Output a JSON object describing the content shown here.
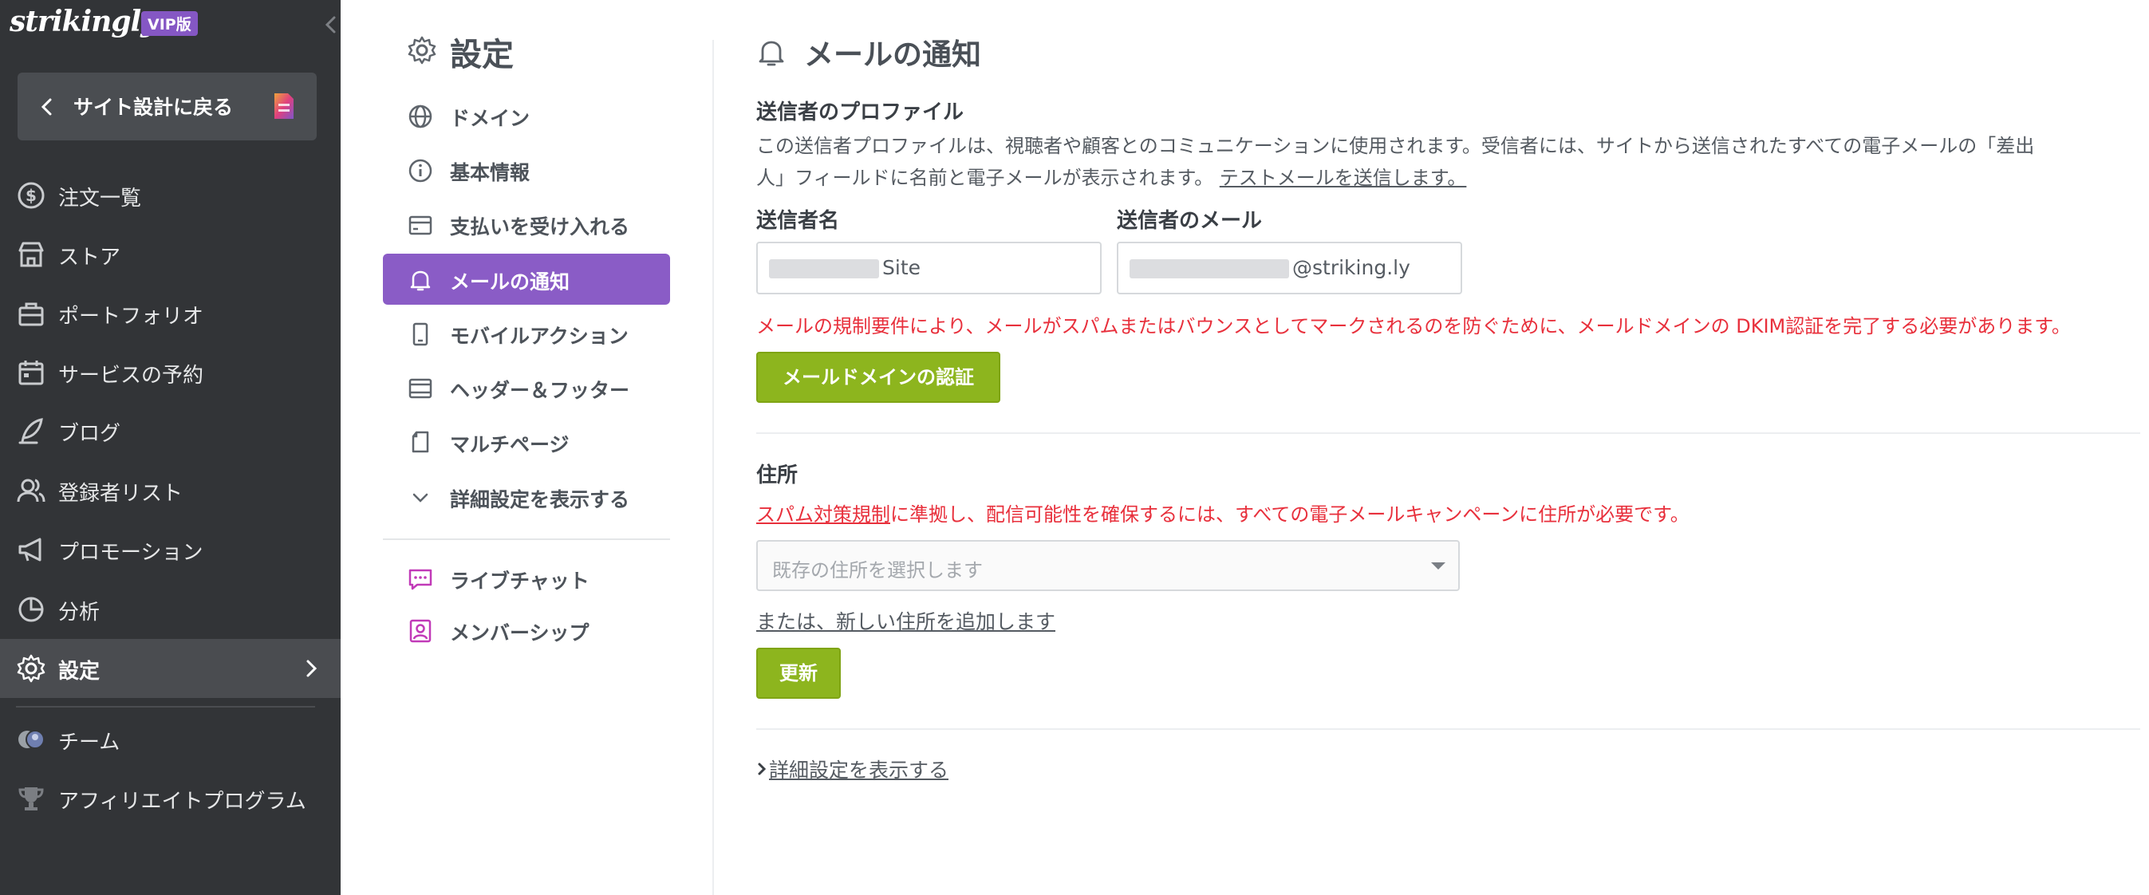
{
  "app": {
    "logo": "strikingly",
    "badge": "VIP版"
  },
  "sidebar": {
    "back_label": "サイト設計に戻る",
    "items": [
      {
        "label": "注文一覧",
        "icon": "dollar-circle-icon"
      },
      {
        "label": "ストア",
        "icon": "store-icon"
      },
      {
        "label": "ポートフォリオ",
        "icon": "briefcase-icon"
      },
      {
        "label": "サービスの予約",
        "icon": "calendar-icon"
      },
      {
        "label": "ブログ",
        "icon": "quill-icon"
      },
      {
        "label": "登録者リスト",
        "icon": "users-icon"
      },
      {
        "label": "プロモーション",
        "icon": "megaphone-icon"
      },
      {
        "label": "分析",
        "icon": "pie-chart-icon"
      },
      {
        "label": "設定",
        "icon": "gear-icon",
        "active": true
      },
      {
        "label": "チーム",
        "icon": "team-avatars-icon"
      },
      {
        "label": "アフィリエイトプログラム",
        "icon": "trophy-icon"
      }
    ]
  },
  "settings_menu": {
    "title": "設定",
    "items": [
      {
        "label": "ドメイン",
        "icon": "globe-icon"
      },
      {
        "label": "基本情報",
        "icon": "info-icon"
      },
      {
        "label": "支払いを受け入れる",
        "icon": "card-icon"
      },
      {
        "label": "メールの通知",
        "icon": "bell-icon",
        "active": true
      },
      {
        "label": "モバイルアクション",
        "icon": "mobile-icon"
      },
      {
        "label": "ヘッダー＆フッター",
        "icon": "layout-icon"
      },
      {
        "label": "マルチページ",
        "icon": "pages-icon"
      },
      {
        "label": "詳細設定を表示する",
        "icon": "chevron-down-icon"
      }
    ],
    "extra_items": [
      {
        "label": "ライブチャット",
        "icon": "chat-icon"
      },
      {
        "label": "メンバーシップ",
        "icon": "member-icon"
      }
    ]
  },
  "main": {
    "title": "メールの通知",
    "sender_profile": {
      "heading": "送信者のプロファイル",
      "description_1": "この送信者プロファイルは、視聴者や顧客とのコミュニケーションに使用されます。受信者には、サイトから送信されたすべての電子メールの「差出",
      "description_2": "人」フィールドに名前と電子メールが表示されます。",
      "test_link": "テストメールを送信します。",
      "name_label": "送信者名",
      "name_value": "Site",
      "email_label": "送信者のメール",
      "email_value": "@striking.ly",
      "dkim_warning": "メールの規制要件により、メールがスパムまたはバウンスとしてマークされるのを防ぐために、メールドメインの DKIM認証を完了する必要があります。",
      "verify_button": "メールドメインの認証"
    },
    "address": {
      "heading": "住所",
      "warning_link": "スパム対策規制",
      "warning_text": "に準拠し、配信可能性を確保するには、すべての電子メールキャンペーンに住所が必要です。",
      "select_placeholder": "既存の住所を選択します",
      "add_link": "または、新しい住所を追加します",
      "update_button": "更新"
    },
    "advanced_link": "詳細設定を表示する"
  },
  "colors": {
    "sidebar_bg": "#323437",
    "accent_purple": "#8a5cc6",
    "button_green": "#8db51e",
    "warning_red": "#e8303c"
  }
}
